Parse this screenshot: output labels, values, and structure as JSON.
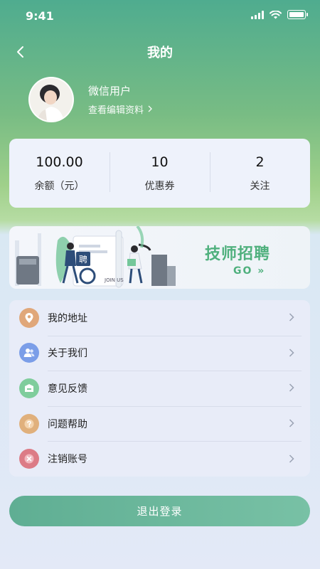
{
  "status_bar": {
    "time": "9:41"
  },
  "nav": {
    "title": "我的"
  },
  "profile": {
    "name": "微信用户",
    "edit_link": "查看编辑资料"
  },
  "stats": [
    {
      "value": "100.00",
      "label": "余额（元）"
    },
    {
      "value": "10",
      "label": "优惠券"
    },
    {
      "value": "2",
      "label": "关注"
    }
  ],
  "banner": {
    "title": "技师招聘",
    "go_label": "GO »",
    "sign_text": "聘",
    "door_text": "JOIN US"
  },
  "menu": {
    "items": [
      {
        "label": "我的地址",
        "icon": "location-pin-icon",
        "color": "#e0a77a"
      },
      {
        "label": "关于我们",
        "icon": "users-icon",
        "color": "#7b9ee8"
      },
      {
        "label": "意见反馈",
        "icon": "feedback-icon",
        "color": "#7fcd9c"
      },
      {
        "label": "问题帮助",
        "icon": "help-icon",
        "color": "#e0b07c"
      },
      {
        "label": "注销账号",
        "icon": "close-circle-icon",
        "color": "#dc7b86"
      }
    ]
  },
  "logout": {
    "label": "退出登录"
  },
  "colors": {
    "accent": "#4fb07d",
    "header_green": "#4fac8f",
    "button": "#66b497"
  }
}
